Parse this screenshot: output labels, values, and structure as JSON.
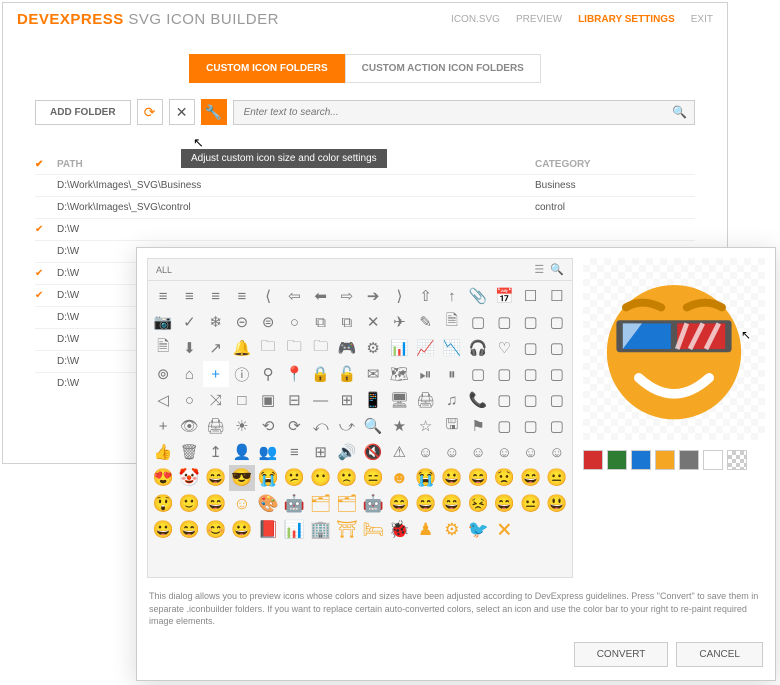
{
  "header": {
    "logo_bold": "DEVEXPRESS",
    "logo_light": " SVG ICON BUILDER",
    "nav": [
      "ICON.SVG",
      "PREVIEW",
      "LIBRARY SETTINGS",
      "EXIT"
    ],
    "active_nav": 2
  },
  "tabs": {
    "items": [
      "CUSTOM ICON FOLDERS",
      "CUSTOM ACTION ICON FOLDERS"
    ],
    "active": 0
  },
  "toolbar": {
    "add_label": "ADD FOLDER",
    "search_placeholder": "Enter text to search...",
    "tooltip": "Adjust custom icon size and color settings"
  },
  "grid": {
    "headers": {
      "path": "PATH",
      "category": "CATEGORY"
    },
    "rows": [
      {
        "checked": false,
        "path": "D:\\Work\\Images\\_SVG\\Business",
        "category": "Business"
      },
      {
        "checked": false,
        "path": "D:\\Work\\Images\\_SVG\\control",
        "category": "control"
      },
      {
        "checked": true,
        "path": "D:\\W",
        "category": ""
      },
      {
        "checked": false,
        "path": "D:\\W",
        "category": ""
      },
      {
        "checked": true,
        "path": "D:\\W",
        "category": ""
      },
      {
        "checked": true,
        "path": "D:\\W",
        "category": ""
      },
      {
        "checked": false,
        "path": "D:\\W",
        "category": ""
      },
      {
        "checked": false,
        "path": "D:\\W",
        "category": ""
      },
      {
        "checked": false,
        "path": "D:\\W",
        "category": ""
      },
      {
        "checked": false,
        "path": "D:\\W",
        "category": ""
      }
    ]
  },
  "dialog": {
    "panel_label": "ALL",
    "help_text": "This dialog allows you to preview icons whose colors and sizes have been adjusted according to DevExpress guidelines. Press \"Convert\" to save them in separate .iconbuilder folders. If you want to replace certain auto-converted colors, select an icon and use the color bar to your right to re-paint required image elements.",
    "convert_label": "CONVERT",
    "cancel_label": "CANCEL",
    "swatches": [
      "#d32f2f",
      "#2e7d32",
      "#1976d2",
      "#f5a623",
      "#757575",
      "#ffffff",
      "checker"
    ],
    "icon_grid": {
      "cols": 16,
      "rows": 11,
      "icons": [
        "≡",
        "≡",
        "≡",
        "≡",
        "⟨",
        "⇦",
        "⬅",
        "⇨",
        "➔",
        "⟩",
        "⇧",
        "↑",
        "📎",
        "📅",
        "☐",
        "☐",
        "📷",
        "✓",
        "❄",
        "⊝",
        "⊜",
        "○",
        "⧉",
        "⧉",
        "✕",
        "✈",
        "✎",
        "🗎",
        "▢",
        "▢",
        "▢",
        "▢",
        "🗎",
        "⬇",
        "↗",
        "🔔",
        "🗀",
        "🗀",
        "🗀",
        "🎮",
        "⚙",
        "📊",
        "📈",
        "📉",
        "🎧",
        "♡",
        "▢",
        "▢",
        "⊚",
        "⌂",
        "+",
        "ⓘ",
        "⚲",
        "📍",
        "🔒",
        "🔓",
        "✉",
        "🗺",
        "⏯",
        "⏸",
        "▢",
        "▢",
        "▢",
        "▢",
        "◁",
        "○",
        "⤨",
        "□",
        "▣",
        "⊟",
        "—",
        "⊞",
        "📱",
        "🖥",
        "🖨",
        "♫",
        "📞",
        "▢",
        "▢",
        "▢",
        "+",
        "👁",
        "🖨",
        "☀",
        "⟲",
        "⟳",
        "⤺",
        "⤻",
        "🔍",
        "★",
        "☆",
        "🖫",
        "⚑",
        "▢",
        "▢",
        "▢",
        "👍",
        "🗑",
        "↥",
        "👤",
        "👥",
        "≡",
        "⊞",
        "🔊",
        "🔇",
        "⚠",
        "☺",
        "☺",
        "☺",
        "☺",
        "☺",
        "☺",
        "😍",
        "🤡",
        "😄",
        "😎",
        "😭",
        "😕",
        "😶",
        "🙁",
        "😑",
        "☻",
        "😭",
        "😀",
        "😄",
        "😟",
        "😄",
        "😐",
        "😲",
        "🙂",
        "😄",
        "☺",
        "🎨",
        "🤖",
        "🗂",
        "🗂",
        "🤖",
        "😄",
        "😄",
        "😄",
        "😣",
        "😄",
        "😐",
        "😃",
        "😀",
        "😄",
        "😊",
        "😀",
        "📕",
        "📊",
        "🏢",
        "⛩",
        "🛏",
        "🐞",
        "♟",
        "⚙",
        "🐦",
        "🗙",
        "",
        "",
        "",
        "",
        "",
        "",
        "",
        "",
        "",
        "",
        "",
        "",
        "",
        "",
        "",
        "",
        "",
        ""
      ]
    }
  }
}
